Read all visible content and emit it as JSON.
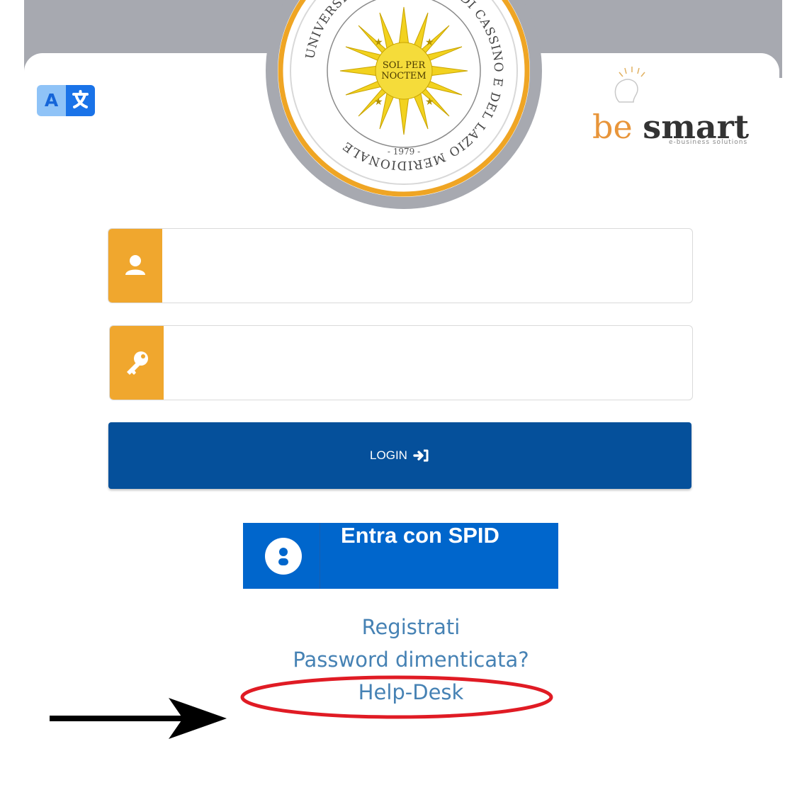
{
  "logo": {
    "seal_text": "UNIVERSITÀ DEGLI STUDI DI CASSINO E DEL LAZIO MERIDIONALE",
    "motto_line1": "SOL PER",
    "motto_line2": "NOCTEM",
    "year": "- 1979 -"
  },
  "partner_logo": {
    "brand_be": "be",
    "brand_smart": "smart",
    "tagline": "e-business solutions"
  },
  "translate_button": {
    "icon": "translate-icon",
    "letter": "A"
  },
  "username_field": {
    "icon": "user-icon",
    "value": "",
    "placeholder": ""
  },
  "password_field": {
    "icon": "key-icon",
    "value": "",
    "placeholder": ""
  },
  "login_button": {
    "label": "LOGIN",
    "icon": "sign-in-icon"
  },
  "spid_button": {
    "label": "Entra con SPID",
    "icon": "spid-user-icon"
  },
  "links": {
    "register": "Registrati",
    "forgot_password": "Password dimenticata?",
    "helpdesk": "Help-Desk"
  },
  "colors": {
    "accent_orange": "#f0a72e",
    "login_blue": "#05509b",
    "spid_blue": "#0066cc",
    "link_blue": "#4682b4",
    "annotation_red": "#e01b24"
  }
}
